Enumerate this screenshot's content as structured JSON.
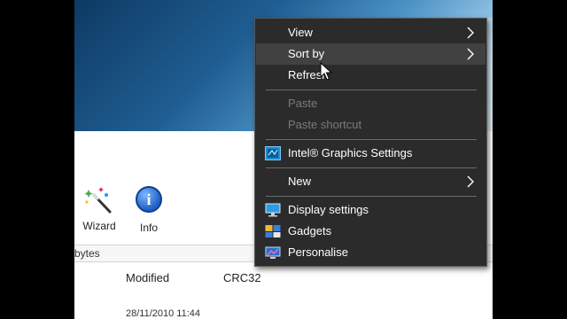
{
  "desktop": {},
  "app": {
    "toolbar": {
      "wizard_label": "Wizard",
      "info_label": "Info"
    },
    "statusbar": {
      "size_text": "bytes"
    },
    "columns": {
      "modified": "Modified",
      "crc": "CRC32"
    },
    "first_row_modified": "28/11/2010 11:44"
  },
  "context_menu": {
    "view": "View",
    "sort_by": "Sort by",
    "refresh": "Refresh",
    "paste": "Paste",
    "paste_shortcut": "Paste shortcut",
    "intel_graphics": "Intel® Graphics Settings",
    "new": "New",
    "display_settings": "Display settings",
    "gadgets": "Gadgets",
    "personalise": "Personalise"
  },
  "colors": {
    "menu_bg": "#2b2b2b",
    "menu_hover": "#414141",
    "menu_disabled_text": "#7a7a7a",
    "menu_separator": "#6b6b6b"
  },
  "icons": {
    "submenu": "chevron-right-icon",
    "wizard": "magic-wand-icon",
    "info": "info-icon",
    "intel": "intel-graphics-icon",
    "display": "display-settings-icon",
    "gadgets": "gadgets-icon",
    "personalise": "personalise-icon",
    "cursor": "mouse-pointer-icon"
  }
}
